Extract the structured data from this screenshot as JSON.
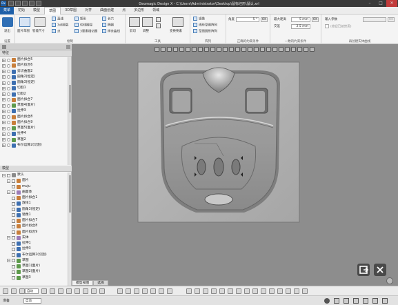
{
  "titlebar": {
    "app_badge": "Dx",
    "title": "Geomagic Design X - C:\\Users\\Administrator\\Desktop\\鼠标坯形\\鼠认.xrl"
  },
  "tabs": [
    "菜单",
    "初始",
    "模型",
    "草图",
    "3D草图",
    "对齐",
    "曲面创建",
    "点",
    "多边形",
    "领域"
  ],
  "active_tab_index": 3,
  "ribbon": {
    "group_setup": {
      "btn_exit": "退出",
      "label": "设置"
    },
    "group_draw_big": {
      "btn_face_sketch": "面片草图",
      "btn_smart_dim": "智能尺寸"
    },
    "draw_items_col1": [
      "直线",
      "3点圆弧",
      "点"
    ],
    "draw_items_col2": [
      "矩形",
      "切线圆弧",
      "3要素相切圆"
    ],
    "draw_items_col3": [
      "长穴",
      "椭圆",
      "样条曲线"
    ],
    "group_draw_label": "绘制",
    "tools": {
      "trim": "剪切",
      "adjust": "调整",
      "convert": "变换要素",
      "label": "工具"
    },
    "array": {
      "mirror": "镜像",
      "linear": "线形草图阵列",
      "circular": "草图圆形阵列",
      "label": "阵列"
    },
    "constraint": {
      "angle_label": "角度",
      "angle_value": "5 °",
      "ok": "OK",
      "label": "正确的约束条件"
    },
    "common": {
      "max_dist_label": "最大距离",
      "max_dist_value": "5 mm",
      "intersect_label": "交差",
      "intersect_value": "2.5 mm",
      "ok": "OK",
      "label": "一致的约束条件"
    },
    "entity": {
      "input_label": "输入参数",
      "checkbox_label": "(按钮已被禁用)",
      "label": "再创建实体曲线"
    }
  },
  "feature_panel": {
    "header": "特征",
    "rows": [
      {
        "label": "面片拟合5",
        "icon": "mesh"
      },
      {
        "label": "面片拟合6",
        "icon": "mesh"
      },
      {
        "label": "剪切曲面2",
        "icon": "feat"
      },
      {
        "label": "圆角2(恒定)",
        "icon": "feat"
      },
      {
        "label": "圆角3(恒定)",
        "icon": "feat"
      },
      {
        "label": "切割1",
        "icon": "feat"
      },
      {
        "label": "切割2",
        "icon": "feat"
      },
      {
        "label": "面片拟合7",
        "icon": "mesh"
      },
      {
        "label": "草图4(面片)",
        "icon": "sketch"
      },
      {
        "label": "拉伸3",
        "icon": "feat"
      },
      {
        "label": "面片拟合8",
        "icon": "mesh"
      },
      {
        "label": "面片拟合9",
        "icon": "mesh"
      },
      {
        "label": "草图5(面片)",
        "icon": "sketch"
      },
      {
        "label": "拉伸4",
        "icon": "feat"
      },
      {
        "label": "草图2",
        "icon": "sketch"
      },
      {
        "label": "布尔运算2(切割)",
        "icon": "feat"
      }
    ]
  },
  "model_panel": {
    "header": "模型",
    "rows": [
      {
        "label": "默认",
        "indent": 0,
        "icon": "ref"
      },
      {
        "label": "面片",
        "indent": 1,
        "icon": "mesh"
      },
      {
        "label": "muju",
        "indent": 2,
        "icon": "mesh"
      },
      {
        "label": "曲面体",
        "indent": 1,
        "icon": "body"
      },
      {
        "label": "面片拟合1",
        "indent": 2,
        "icon": "mesh"
      },
      {
        "label": "放样1",
        "indent": 2,
        "icon": "feat"
      },
      {
        "label": "圆角3(恒定)",
        "indent": 2,
        "icon": "feat"
      },
      {
        "label": "镜像1",
        "indent": 2,
        "icon": "feat"
      },
      {
        "label": "面片拟合7",
        "indent": 2,
        "icon": "mesh"
      },
      {
        "label": "面片拟合8",
        "indent": 2,
        "icon": "mesh"
      },
      {
        "label": "面片拟合9",
        "indent": 2,
        "icon": "mesh"
      },
      {
        "label": "实体",
        "indent": 1,
        "icon": "body"
      },
      {
        "label": "拉伸1",
        "indent": 2,
        "icon": "feat"
      },
      {
        "label": "拉伸3",
        "indent": 2,
        "icon": "feat"
      },
      {
        "label": "布尔运算2(切割)",
        "indent": 2,
        "icon": "feat"
      },
      {
        "label": "草图",
        "indent": 1,
        "icon": "sketch"
      },
      {
        "label": "草图1(面片)",
        "indent": 2,
        "icon": "sketch"
      },
      {
        "label": "草图2(面片)",
        "indent": 2,
        "icon": "sketch"
      },
      {
        "label": "草图3",
        "indent": 2,
        "icon": "sketch"
      }
    ]
  },
  "viewport": {
    "tabs": [
      "模型视图",
      "选择"
    ],
    "confirm_icon": "exit-sketch-icon",
    "cancel_icon": "close-icon"
  },
  "statusbar": {
    "left": "准备",
    "mode_select": "自动"
  }
}
